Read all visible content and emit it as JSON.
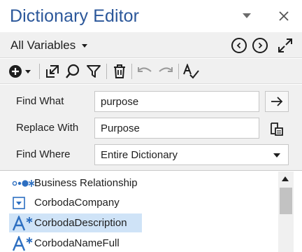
{
  "window": {
    "title": "Dictionary Editor"
  },
  "scope": {
    "selected": "All Variables"
  },
  "toolbar": {
    "icons": [
      "add-icon",
      "goto-icon",
      "search-icon",
      "filter-icon",
      "delete-icon",
      "undo-icon",
      "redo-icon",
      "spellcheck-icon"
    ]
  },
  "find": {
    "find_label": "Find What",
    "find_value": "purpose",
    "replace_label": "Replace With",
    "replace_value": "Purpose",
    "where_label": "Find Where",
    "where_value": "Entire Dictionary"
  },
  "tree": {
    "items": [
      {
        "label": "Business Relationship",
        "icon": "relationship-icon",
        "selected": false
      },
      {
        "label": "CorbodaCompany",
        "icon": "dropdown-field-icon",
        "selected": false
      },
      {
        "label": "CorbodaDescription",
        "icon": "text-field-icon",
        "selected": true
      },
      {
        "label": "CorbodaNameFull",
        "icon": "text-field-icon",
        "selected": false
      }
    ]
  },
  "colors": {
    "accent": "#2b579a",
    "icon_blue": "#2d6fc1",
    "selection": "#cfe3f7",
    "panel": "#f0f0f0"
  }
}
